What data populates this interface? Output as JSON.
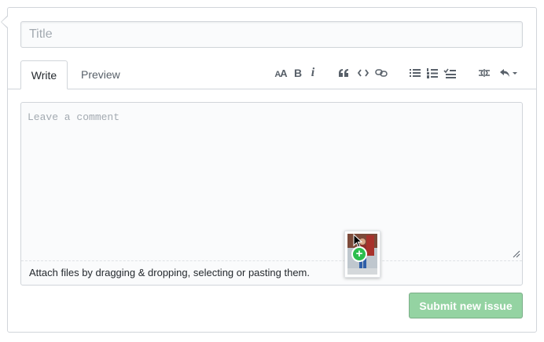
{
  "form": {
    "title_placeholder": "Title",
    "title_value": ""
  },
  "tabs": [
    {
      "label": "Write",
      "selected": true
    },
    {
      "label": "Preview",
      "selected": false
    }
  ],
  "toolbar": {
    "buttons": [
      {
        "name": "header-text",
        "glyph": "AA"
      },
      {
        "name": "bold",
        "glyph": "B"
      },
      {
        "name": "italic",
        "glyph": "i"
      },
      {
        "name": "quote-icon"
      },
      {
        "name": "code-icon"
      },
      {
        "name": "link-icon"
      },
      {
        "name": "unordered-list-icon"
      },
      {
        "name": "ordered-list-icon"
      },
      {
        "name": "task-list-icon"
      },
      {
        "name": "mention-icon"
      },
      {
        "name": "saved-replies-icon"
      }
    ]
  },
  "editor": {
    "placeholder": "Leave a comment",
    "value": "",
    "attach_hint": "Attach files by dragging & dropping, selecting or pasting them."
  },
  "drag": {
    "plus_glyph": "+"
  },
  "actions": {
    "submit_label": "Submit new issue",
    "submit_color": "#94d3a2"
  }
}
